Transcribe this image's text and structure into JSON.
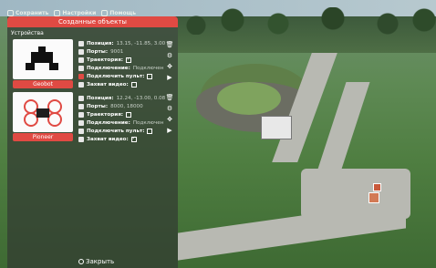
{
  "topbar": {
    "items": [
      {
        "label": "Сохранить",
        "icon": "save-icon"
      },
      {
        "label": "Настройки",
        "icon": "settings-icon"
      },
      {
        "label": "Помощь",
        "icon": "help-icon"
      }
    ]
  },
  "panel": {
    "title": "Созданные объекты",
    "section_title": "Устройства",
    "close_label": "Закрыть"
  },
  "devices": [
    {
      "button_label": "Geobot",
      "position_label": "Позиция:",
      "position_value": "13.15, -11.85, 3.00",
      "ports_label": "Порты:",
      "ports_value": "9001",
      "trajectory_label": "Траектория:",
      "trajectory_checked": true,
      "connection_label": "Подключение:",
      "connection_value": "Подключен",
      "remote_label": "Подключить пульт:",
      "remote_checked": false,
      "video_label": "Захват видео:",
      "video_checked": false
    },
    {
      "button_label": "Pioneer",
      "position_label": "Позиция:",
      "position_value": "12.24, -13.00, 0.08",
      "ports_label": "Порты:",
      "ports_value": "8000, 18000",
      "trajectory_label": "Траектория:",
      "trajectory_checked": false,
      "connection_label": "Подключение:",
      "connection_value": "Подключен",
      "remote_label": "Подключить пульт:",
      "remote_checked": false,
      "video_label": "Захват видео:",
      "video_checked": true
    }
  ],
  "colors": {
    "accent": "#e04a43",
    "panel_bg": "#323a32"
  }
}
